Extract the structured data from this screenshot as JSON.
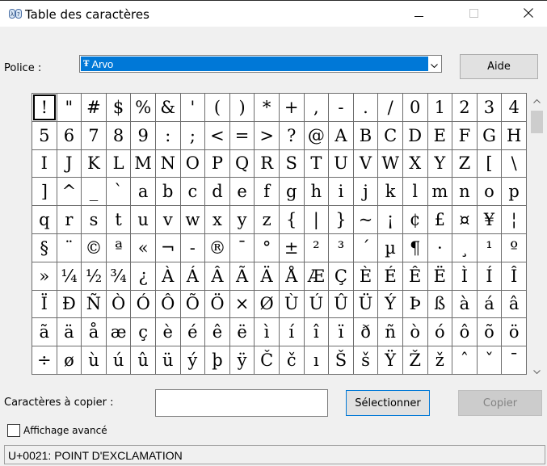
{
  "window": {
    "title": "Table des caractères",
    "icons": {
      "app": "charmap-icon",
      "minimize": "minimize-icon",
      "maximize": "maximize-icon",
      "close": "close-icon"
    }
  },
  "font": {
    "label": "Police :",
    "selected": "Arvo",
    "font_icon": "Ŧ",
    "help_button": "Aide"
  },
  "grid": {
    "selected_index": 0,
    "rows": [
      [
        "!",
        "\"",
        "#",
        "$",
        "%",
        "&",
        "'",
        "(",
        ")",
        "*",
        "+",
        ",",
        "-",
        ".",
        "/",
        "0",
        "1",
        "2",
        "3",
        "4"
      ],
      [
        "5",
        "6",
        "7",
        "8",
        "9",
        ":",
        ";",
        "<",
        "=",
        ">",
        "?",
        "@",
        "A",
        "B",
        "C",
        "D",
        "E",
        "F",
        "G",
        "H"
      ],
      [
        "I",
        "J",
        "K",
        "L",
        "M",
        "N",
        "O",
        "P",
        "Q",
        "R",
        "S",
        "T",
        "U",
        "V",
        "W",
        "X",
        "Y",
        "Z",
        "[",
        "\\"
      ],
      [
        "]",
        "^",
        "_",
        "`",
        "a",
        "b",
        "c",
        "d",
        "e",
        "f",
        "g",
        "h",
        "i",
        "j",
        "k",
        "l",
        "m",
        "n",
        "o",
        "p"
      ],
      [
        "q",
        "r",
        "s",
        "t",
        "u",
        "v",
        "w",
        "x",
        "y",
        "z",
        "{",
        "|",
        "}",
        "~",
        "¡",
        "¢",
        "£",
        "¤",
        "¥",
        "¦"
      ],
      [
        "§",
        "¨",
        "©",
        "ª",
        "«",
        "¬",
        "-",
        "®",
        "¯",
        "°",
        "±",
        "²",
        "³",
        "´",
        "µ",
        "¶",
        "·",
        "¸",
        "¹",
        "º"
      ],
      [
        "»",
        "¼",
        "½",
        "¾",
        "¿",
        "À",
        "Á",
        "Â",
        "Ã",
        "Ä",
        "Å",
        "Æ",
        "Ç",
        "È",
        "É",
        "Ê",
        "Ë",
        "Ì",
        "Í",
        "Î"
      ],
      [
        "Ï",
        "Ð",
        "Ñ",
        "Ò",
        "Ó",
        "Ô",
        "Õ",
        "Ö",
        "×",
        "Ø",
        "Ù",
        "Ú",
        "Û",
        "Ü",
        "Ý",
        "Þ",
        "ß",
        "à",
        "á",
        "â"
      ],
      [
        "ã",
        "ä",
        "å",
        "æ",
        "ç",
        "è",
        "é",
        "ê",
        "ë",
        "ì",
        "í",
        "î",
        "ï",
        "ð",
        "ñ",
        "ò",
        "ó",
        "ô",
        "õ",
        "ö"
      ],
      [
        "÷",
        "ø",
        "ù",
        "ú",
        "û",
        "ü",
        "ý",
        "þ",
        "ÿ",
        "Č",
        "č",
        "ı",
        "Š",
        "š",
        "Ÿ",
        "Ž",
        "ž",
        "ˆ",
        "ˇ",
        "¯"
      ]
    ]
  },
  "copy": {
    "label": "Caractères à copier :",
    "value": "",
    "select_button": "Sélectionner",
    "copy_button": "Copier"
  },
  "advanced": {
    "label": "Affichage avancé",
    "checked": false
  },
  "status": {
    "text": "U+0021: POINT D'EXCLAMATION"
  },
  "colors": {
    "selection": "#0078d7",
    "window_bg": "#f0f0f0"
  }
}
